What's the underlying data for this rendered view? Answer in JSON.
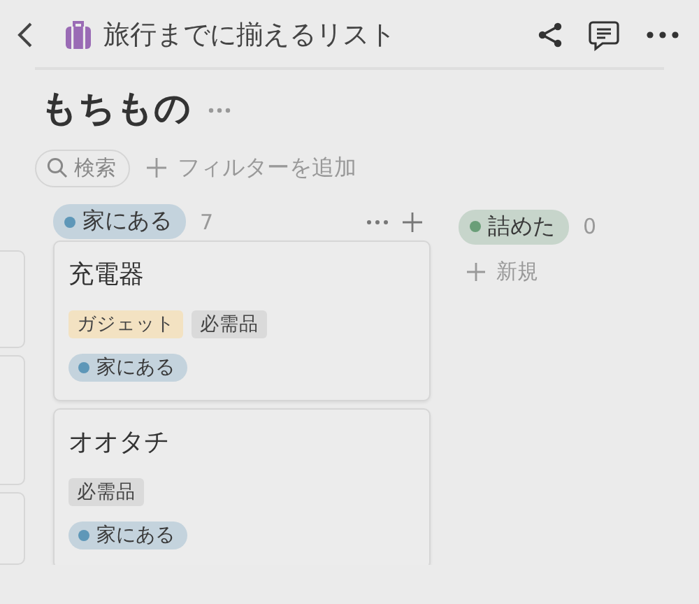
{
  "header": {
    "title": "旅行までに揃えるリスト"
  },
  "page": {
    "title": "もちもの"
  },
  "toolbar": {
    "search": {
      "placeholder": "検索"
    },
    "add_filter": "フィルターを追加"
  },
  "columns": [
    {
      "status": "家にある",
      "color": "#5e97b8",
      "count": "7",
      "show_actions": true,
      "cards": [
        {
          "title": "充電器",
          "tags": [
            {
              "label": "ガジェット",
              "color": "#f3e2c2"
            },
            {
              "label": "必需品",
              "color": "#dadada"
            }
          ],
          "status": {
            "label": "家にある",
            "color": "#5e97b8"
          }
        },
        {
          "title": "オオタチ",
          "tags": [
            {
              "label": "必需品",
              "color": "#dadada"
            }
          ],
          "status": {
            "label": "家にある",
            "color": "#5e97b8"
          }
        }
      ]
    },
    {
      "status": "詰めた",
      "color": "#6a9e78",
      "count": "0",
      "show_actions": false,
      "new_label": "新規"
    }
  ]
}
